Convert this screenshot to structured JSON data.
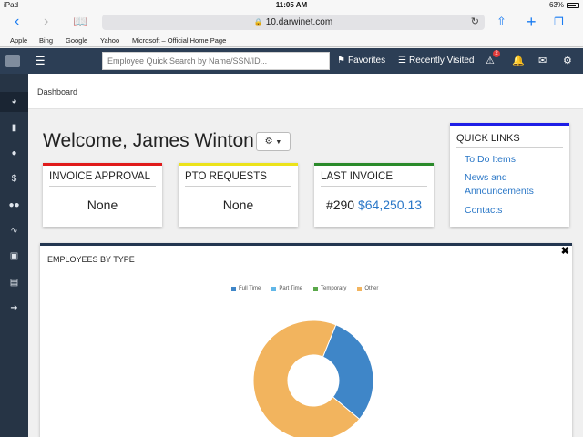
{
  "status_bar": {
    "device": "iPad",
    "time": "11:05 AM",
    "battery": "63%"
  },
  "browser": {
    "url": "10.darwinet.com",
    "bookmarks": [
      "Apple",
      "Bing",
      "Google",
      "Yahoo",
      "Microsoft – Official Home Page"
    ]
  },
  "header": {
    "search_placeholder": "Employee Quick Search by Name/SSN/ID...",
    "favorites": "Favorites",
    "recently_visited": "Recently Visited",
    "alert_count": "2"
  },
  "breadcrumb": "Dashboard",
  "welcome": "Welcome, James Winton",
  "cards": {
    "invoice_approval": {
      "title": "INVOICE APPROVAL",
      "value": "None",
      "color": "#e01b1b"
    },
    "pto_requests": {
      "title": "PTO REQUESTS",
      "value": "None",
      "color": "#ece31a"
    },
    "last_invoice": {
      "title": "LAST INVOICE",
      "number": "#290",
      "amount": "$64,250.13",
      "color": "#2a8a2a"
    }
  },
  "quick_links": {
    "title": "QUICK LINKS",
    "items": [
      "To Do Items",
      "News and Announcements",
      "Contacts"
    ]
  },
  "chart_panel_title": "EMPLOYEES BY TYPE",
  "chart_data": {
    "type": "pie",
    "categories": [
      "Full Time",
      "Part Time",
      "Temporary",
      "Other"
    ],
    "values": [
      30,
      0,
      0,
      70
    ],
    "colors": [
      "#3f86c8",
      "#61b7e8",
      "#5aa84a",
      "#f2b45e"
    ],
    "legend": "top"
  }
}
